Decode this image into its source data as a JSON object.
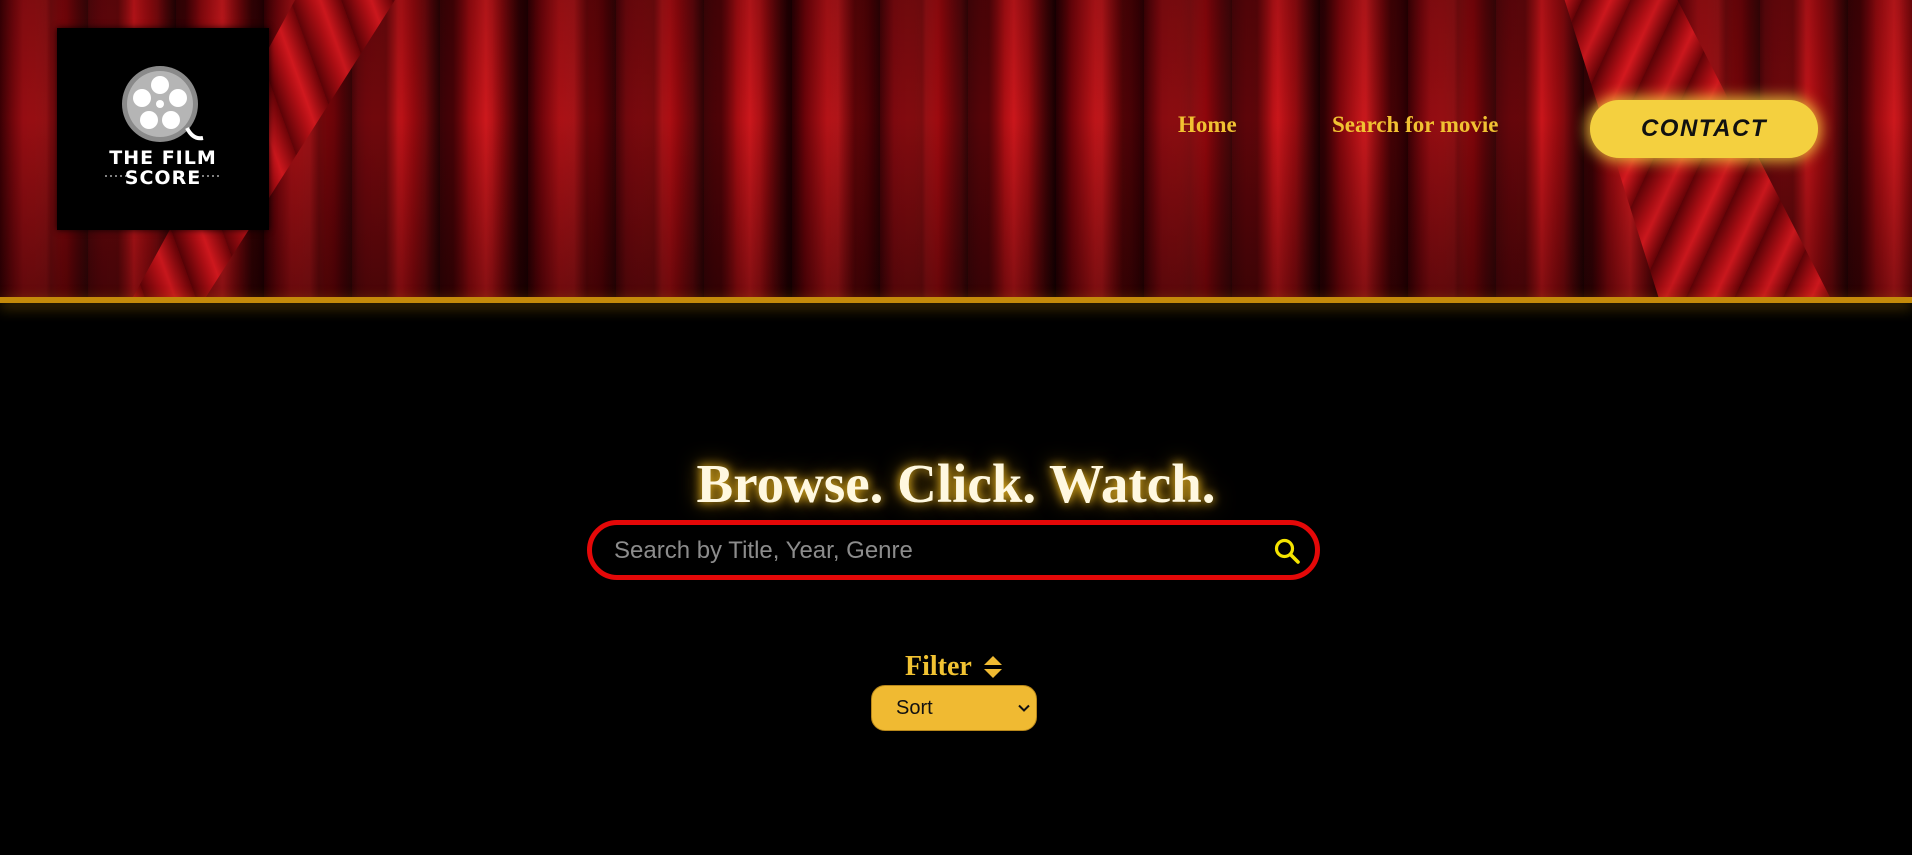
{
  "brand": {
    "logo_line1": "THE FILM",
    "logo_line2": "SCORE",
    "icon": "film-reel-icon"
  },
  "nav": {
    "home_label": "Home",
    "search_label": "Search for movie",
    "contact_label": "CONTACT"
  },
  "hero": {
    "tagline": "Browse. Click. Watch."
  },
  "search": {
    "placeholder": "Search by Title, Year, Genre",
    "value": "",
    "icon": "search-icon"
  },
  "filter": {
    "label": "Filter",
    "icon": "sort-icon",
    "selected": "Sort"
  },
  "colors": {
    "accent": "#f1c232",
    "contact_bg": "#f4d03f",
    "search_border": "#e40808",
    "select_bg": "#f0ba32",
    "background": "#000000",
    "curtain": "#b40f15"
  }
}
